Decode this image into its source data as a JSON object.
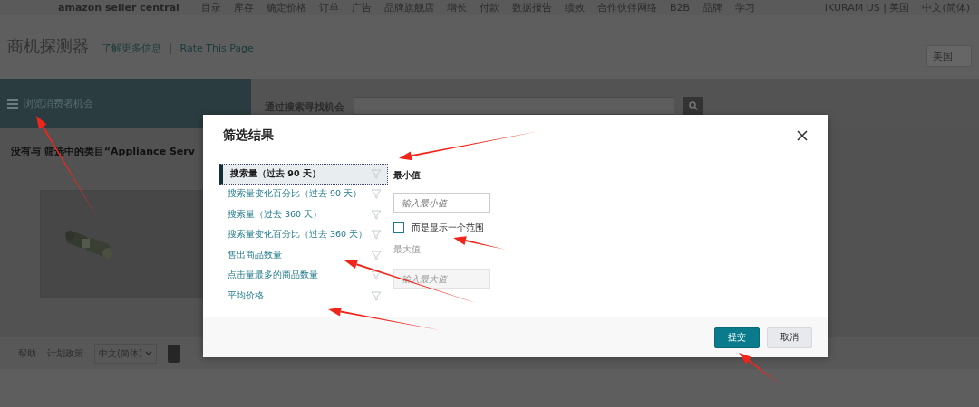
{
  "top_nav": {
    "logo": "amazon seller central",
    "items": [
      "目录",
      "库存",
      "确定价格",
      "订单",
      "广告",
      "品牌旗舰店",
      "增长",
      "付款",
      "数据报告",
      "绩效",
      "合作伙伴网络",
      "B2B",
      "品牌",
      "学习"
    ],
    "store": "IKURAM US | 美国",
    "language": "中文(简体)"
  },
  "header": {
    "title": "商机探测器",
    "links": [
      "了解更多信息",
      "Rate This Page"
    ],
    "marketplace": "美国"
  },
  "band": {
    "menu_label": "浏览消费者机会",
    "search_label": "通过搜索寻找机会"
  },
  "content": {
    "headline": "没有与 筛选中的类目“Appliance Serv"
  },
  "footer": {
    "links": [
      "帮助",
      "计划政策"
    ],
    "language": "中文(简体)"
  },
  "dialog": {
    "title": "筛选结果",
    "filters": [
      {
        "label": "搜索量（过去 90 天）",
        "selected": true
      },
      {
        "label": "搜索量变化百分比（过去 90 天）",
        "selected": false
      },
      {
        "label": "搜索量（过去 360 天）",
        "selected": false
      },
      {
        "label": "搜索量变化百分比（过去 360 天）",
        "selected": false
      },
      {
        "label": "售出商品数量",
        "selected": false
      },
      {
        "label": "点击量最多的商品数量",
        "selected": false
      },
      {
        "label": "平均价格",
        "selected": false
      }
    ],
    "min_field": {
      "label": "最小值",
      "placeholder": "输入最小值"
    },
    "range_checkbox": {
      "label": "而是显示一个范围",
      "checked": false
    },
    "max_field": {
      "label": "最大值",
      "placeholder": "输入最大值",
      "disabled": true
    },
    "buttons": [
      {
        "label": "提交",
        "kind": "primary"
      },
      {
        "label": "取消",
        "kind": "secondary"
      }
    ]
  }
}
